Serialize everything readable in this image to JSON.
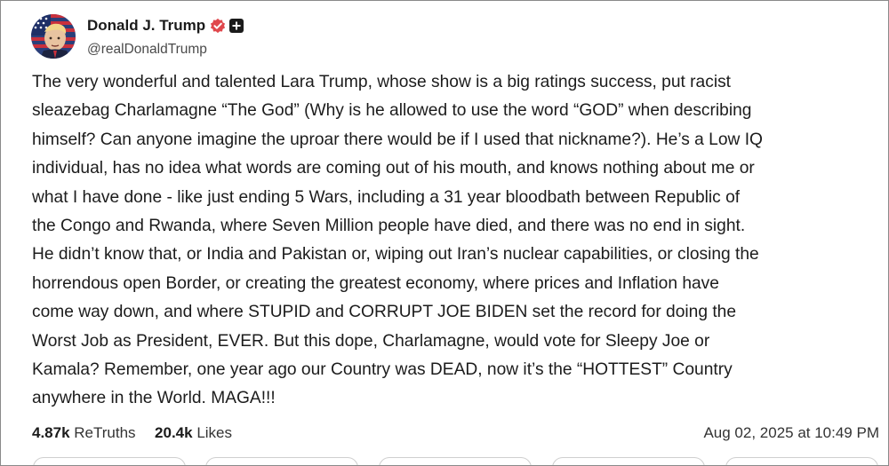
{
  "author": {
    "name": "Donald J. Trump",
    "handle": "@realDonaldTrump",
    "verified_color": "#e0474c"
  },
  "post": {
    "lines": [
      "The very wonderful and talented Lara Trump, whose show is a big ratings success, put racist",
      "sleazebag Charlamagne “The God” (Why is he allowed  to use the word “GOD” when describing",
      "himself? Can anyone imagine the uproar there would be if I used that nickname?). He’s a Low IQ",
      "individual, has no idea what words are coming out of his mouth, and knows nothing about me or",
      "what I have done - like just ending 5 Wars, including a 31 year bloodbath between Republic of",
      "the Congo and Rwanda, where Seven Million people have died, and there was no end in sight.",
      "He didn’t know that, or India and Pakistan or, wiping out Iran’s nuclear capabilities, or closing the",
      "horrendous open Border, or creating the greatest economy, where prices and Inflation have",
      "come way down, and where STUPID and CORRUPT JOE BIDEN set the record for doing the",
      "Worst Job as President, EVER. But this dope, Charlamagne, would vote for Sleepy Joe or",
      "Kamala? Remember, one year ago our Country was DEAD, now it’s the “HOTTEST” Country",
      "anywhere in the World. MAGA!!!"
    ]
  },
  "stats": {
    "retruths_count": "4.87k",
    "retruths_label": "ReTruths",
    "likes_count": "20.4k",
    "likes_label": "Likes"
  },
  "timestamp": "Aug 02, 2025 at 10:49 PM",
  "icons": {
    "verified": "verified-badge-icon",
    "plus": "plus-badge-icon"
  }
}
